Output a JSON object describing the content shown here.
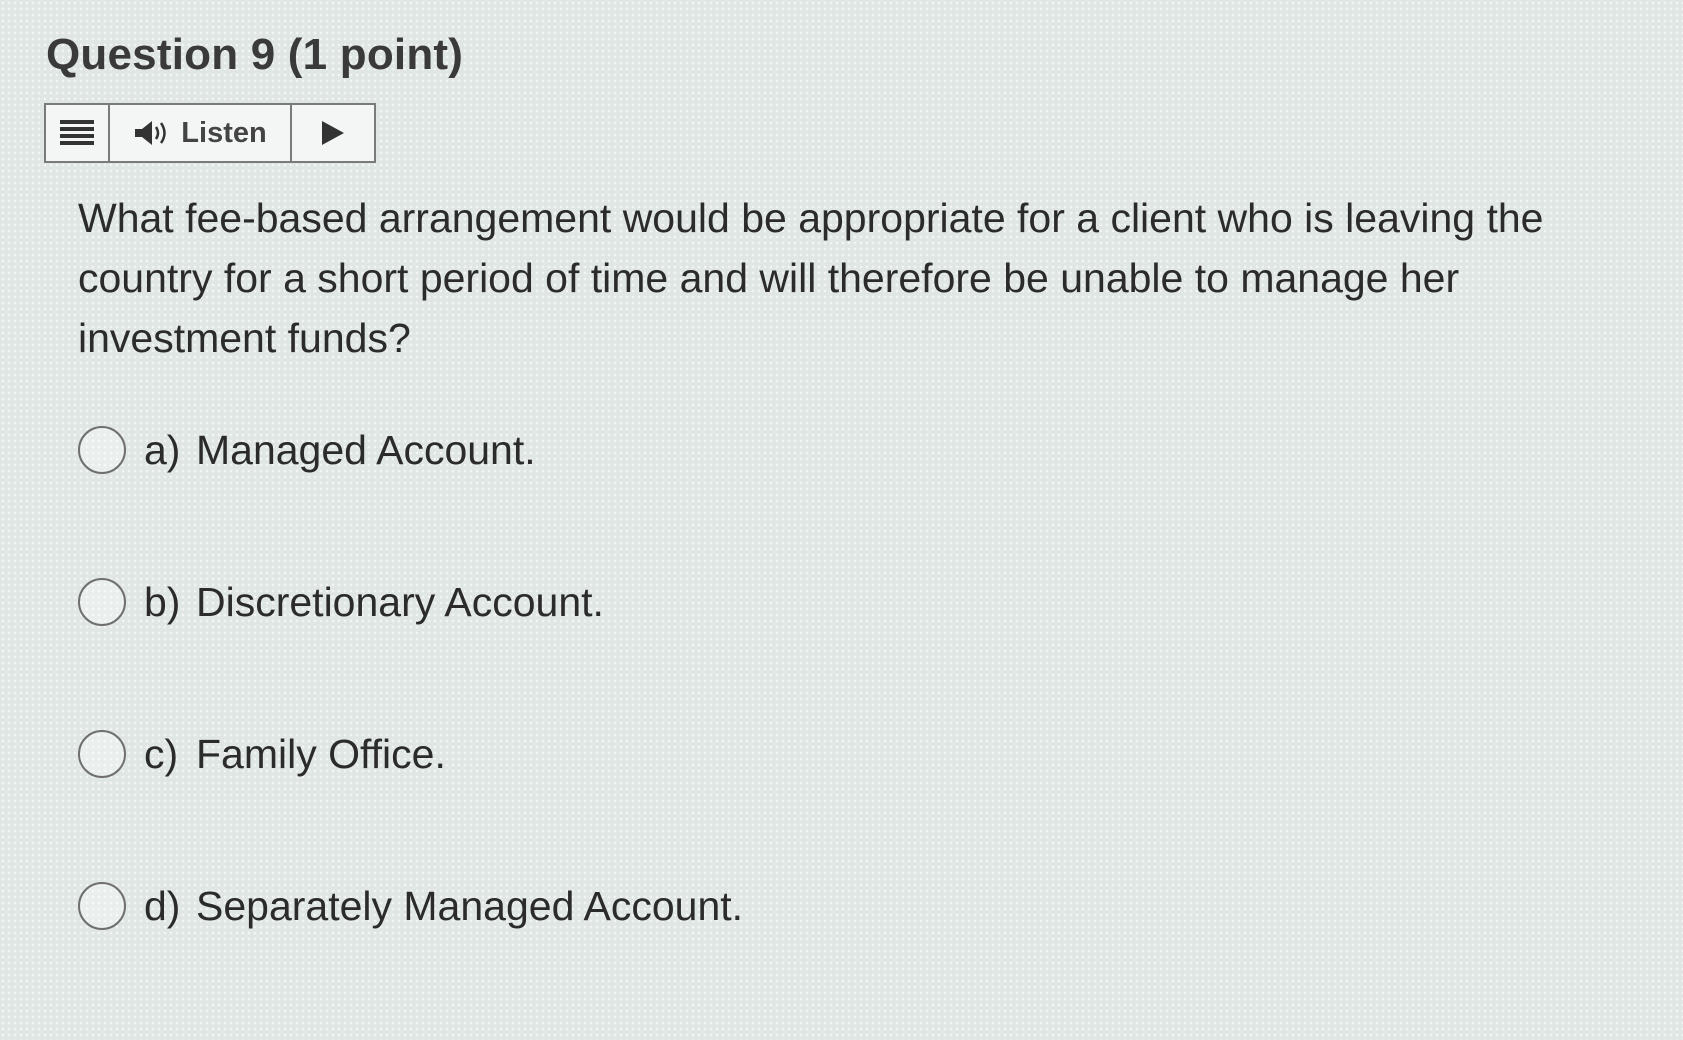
{
  "question": {
    "title": "Question 9 (1 point)",
    "text": "What fee-based arrangement would be appropriate for a client who is leaving the country for a short period of time and will therefore be unable to manage her investment funds?"
  },
  "toolbar": {
    "listen_label": "Listen",
    "icons": [
      "menu-icon",
      "speaker-icon",
      "play-icon"
    ]
  },
  "options": [
    {
      "letter": "a)",
      "text": "Managed Account."
    },
    {
      "letter": "b)",
      "text": "Discretionary Account."
    },
    {
      "letter": "c)",
      "text": "Family Office."
    },
    {
      "letter": "d)",
      "text": "Separately Managed Account."
    }
  ],
  "colors": {
    "background": "#dfe6e4",
    "text": "#2b2b2b",
    "border": "#7a7a7a"
  }
}
